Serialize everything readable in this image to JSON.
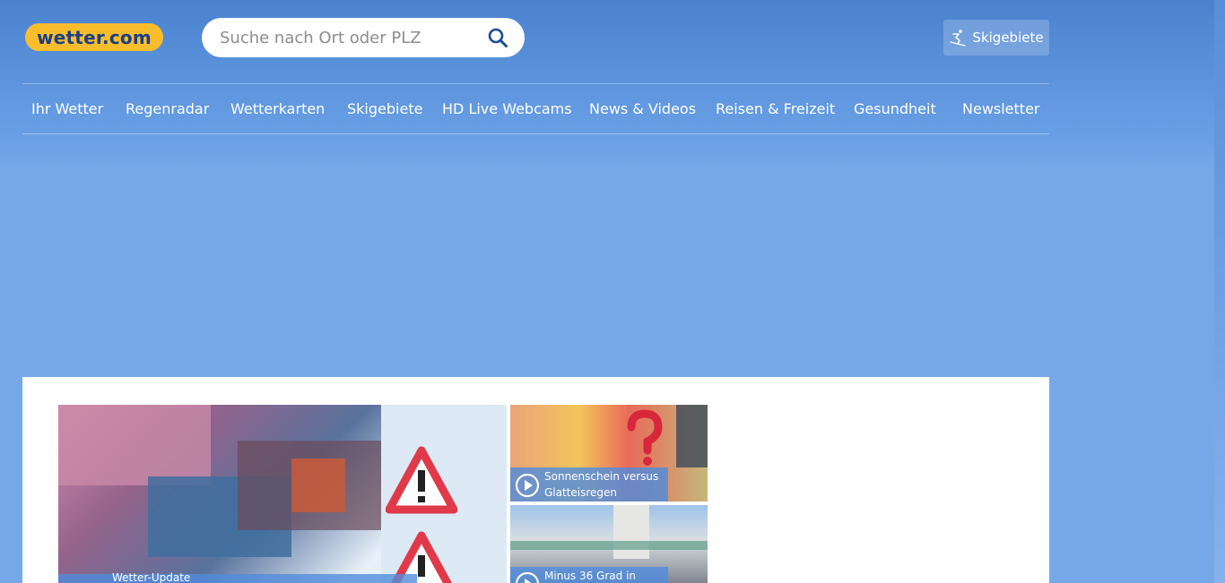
{
  "header": {
    "logo_text": "wetter.com",
    "search_placeholder": "Suche nach Ort oder PLZ",
    "ski_button_label": "Skigebiete"
  },
  "nav": {
    "items": [
      {
        "label": "Ihr Wetter"
      },
      {
        "label": "Regenradar"
      },
      {
        "label": "Wetterkarten"
      },
      {
        "label": "Skigebiete"
      },
      {
        "label": "HD Live Webcams"
      },
      {
        "label": "News & Videos"
      },
      {
        "label": "Reisen & Freizeit"
      },
      {
        "label": "Gesundheit"
      },
      {
        "label": "Newsletter"
      }
    ]
  },
  "videos": {
    "main_caption": "Wetter-Update",
    "side": [
      {
        "title": "Sonnenschein versus Glatteisregen"
      },
      {
        "title": "Minus 36 Grad in"
      }
    ]
  },
  "colors": {
    "logo_bg": "#f9bd2c",
    "logo_text": "#1a3f86",
    "header_bg": "#4a82cf",
    "page_bg": "#76a8e9"
  },
  "icons": {
    "search": "search-icon",
    "ski": "skier-icon",
    "play": "play-icon"
  }
}
